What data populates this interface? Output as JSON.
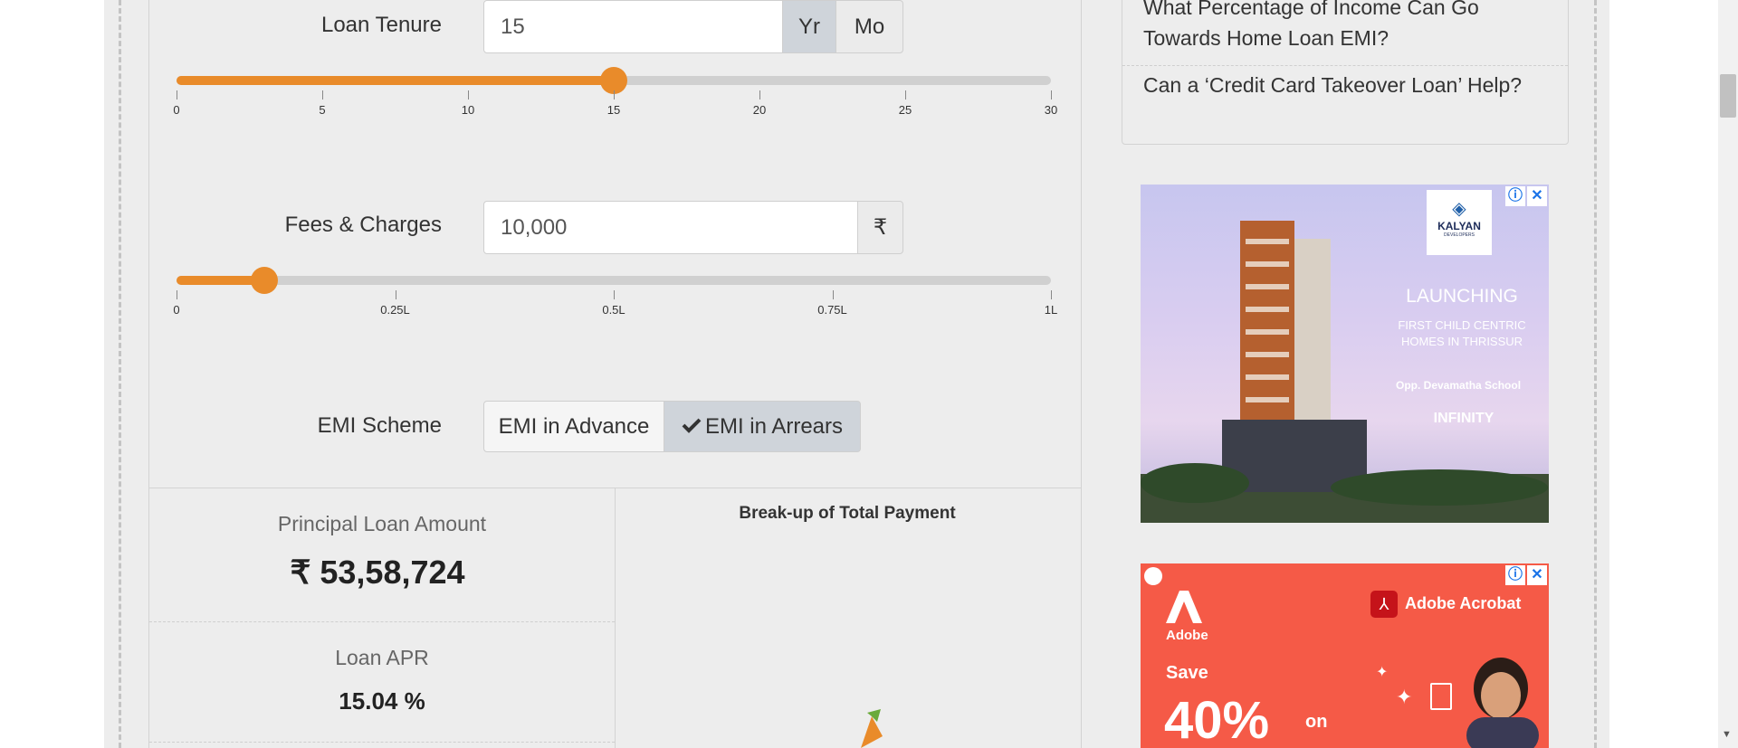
{
  "loan_tenure": {
    "label": "Loan Tenure",
    "value": "15",
    "unit_year": "Yr",
    "unit_month": "Mo",
    "slider_fraction": 0.5,
    "ticks": [
      "0",
      "5",
      "10",
      "15",
      "20",
      "25",
      "30"
    ]
  },
  "fees": {
    "label": "Fees & Charges",
    "value": "10,000",
    "currency": "₹",
    "slider_fraction": 0.1,
    "ticks": [
      "0",
      "0.25L",
      "0.5L",
      "0.75L",
      "1L"
    ]
  },
  "emi_scheme": {
    "label": "EMI Scheme",
    "option_advance": "EMI in Advance",
    "option_arrears": "EMI in Arrears",
    "selected": "EMI in Arrears"
  },
  "results": {
    "principal_label": "Principal Loan Amount",
    "principal_value": "₹ 53,58,724",
    "apr_label": "Loan APR",
    "apr_value": "15.04 %",
    "chart_title": "Break-up of Total Payment"
  },
  "sidebar": {
    "link_1_line1": "What Percentage of Income Can Go",
    "link_1_line2": "Towards Home Loan EMI?",
    "link_2": "Can a ‘Credit Card Takeover Loan’ Help?"
  },
  "ad_kalyan": {
    "brand": "KALYAN",
    "brand_sub": "DEVELOPERS",
    "headline": "LAUNCHING",
    "line1": "FIRST CHILD CENTRIC",
    "line2": "HOMES IN THRISSUR",
    "location": "Opp. Devamatha School",
    "project": "INFINITY"
  },
  "ad_adobe": {
    "brand_small": "Adobe",
    "product": "Adobe Acrobat",
    "save": "Save",
    "percent": "40%",
    "on": "on"
  },
  "colors": {
    "accent": "#e98b2a",
    "ad_red": "#f55a47"
  }
}
